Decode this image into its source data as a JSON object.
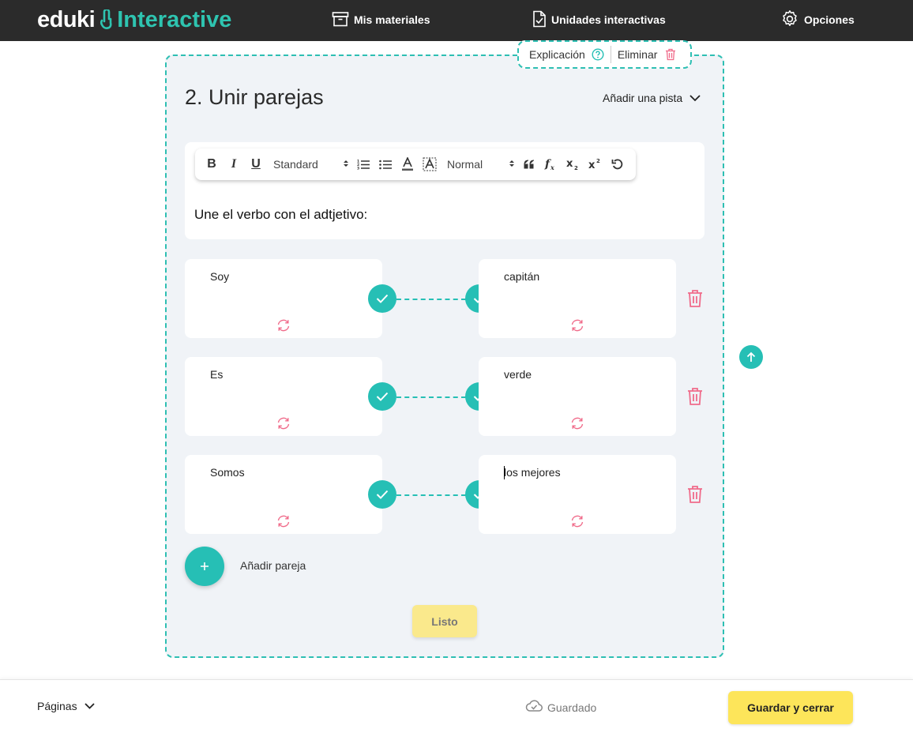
{
  "header": {
    "logo_left": "eduki",
    "logo_right": "Interactive",
    "nav": [
      {
        "label": "Mis materiales",
        "icon": "archive-box-icon"
      },
      {
        "label": "Unidades interactivas",
        "icon": "document-check-icon"
      },
      {
        "label": "Opciones",
        "icon": "gear-icon"
      }
    ]
  },
  "card": {
    "actions": {
      "explanation": "Explicación",
      "delete": "Eliminar"
    },
    "title": "2. Unir parejas",
    "hint": "Añadir una pista",
    "toolbar": {
      "font_select": "Standard",
      "size_select": "Normal"
    },
    "prompt": "Une el verbo con el adtjetivo:",
    "pairs": [
      {
        "left": "Soy",
        "right": "capitán"
      },
      {
        "left": "Es",
        "right": "verde"
      },
      {
        "left": "Somos",
        "right": "los mejores"
      }
    ],
    "add_pair": "Añadir pareja",
    "done": "Listo"
  },
  "footer": {
    "pages": "Páginas",
    "status": "Guardado",
    "save_close": "Guardar y cerrar"
  },
  "colors": {
    "accent": "#26bfb5",
    "header_bg": "#2b2b2b",
    "delete": "#f06b8a",
    "primary_button": "#fde55a",
    "done_button": "#fae98c"
  }
}
